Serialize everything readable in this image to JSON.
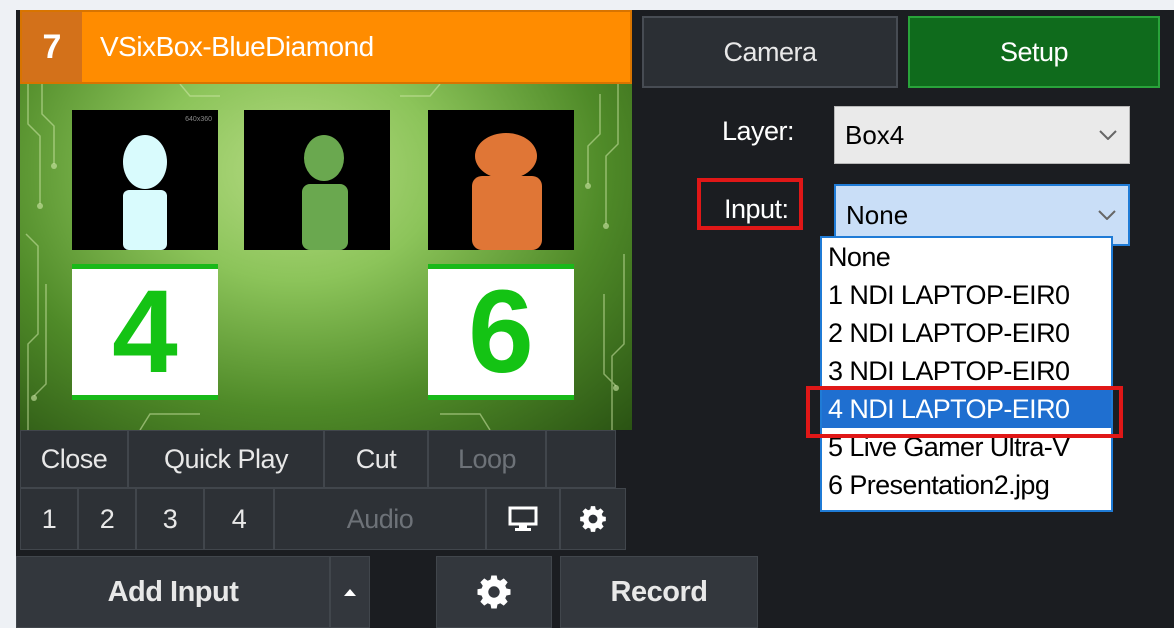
{
  "input": {
    "number": "7",
    "title": "VSixBox-BlueDiamond",
    "preview_res": "640x360",
    "box_labels": [
      "4",
      "6"
    ]
  },
  "controls": {
    "row1": [
      "Close",
      "Quick Play",
      "Cut",
      "Loop"
    ],
    "row2": [
      "1",
      "2",
      "3",
      "4"
    ],
    "audio": "Audio"
  },
  "toolbar": {
    "add_input": "Add Input",
    "record": "Record"
  },
  "tabs": {
    "camera": "Camera",
    "setup": "Setup"
  },
  "layer": {
    "label": "Layer:",
    "value": "Box4"
  },
  "source": {
    "label": "Input:",
    "value": "None",
    "options": [
      "None",
      "1 NDI LAPTOP-EIR0",
      "2 NDI LAPTOP-EIR0",
      "3 NDI LAPTOP-EIR0",
      "4 NDI LAPTOP-EIR0",
      "5 Live Gamer Ultra-V",
      "6 Presentation2.jpg"
    ],
    "highlighted_index": 4
  },
  "colors": {
    "title_bar": "#ff8c00",
    "setup_tab": "#0f6b1c",
    "highlight_box": "#e01717",
    "selection": "#1f6fd0"
  }
}
